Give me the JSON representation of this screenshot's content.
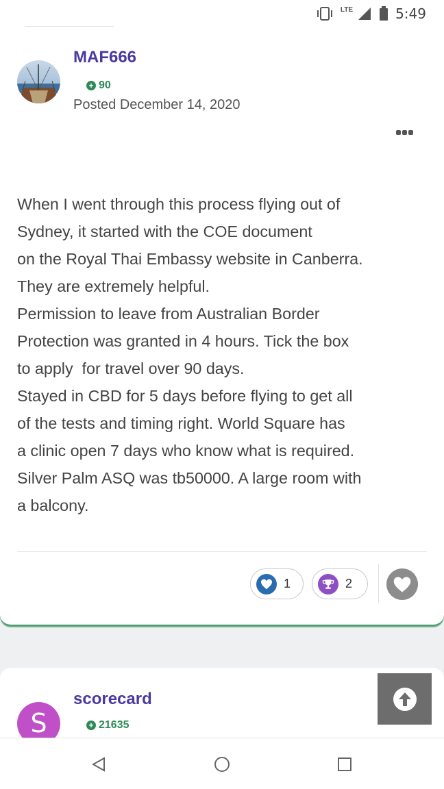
{
  "status_bar": {
    "time": "5:49",
    "network": "LTE",
    "icons": [
      "vibrate-icon",
      "signal-icon",
      "battery-icon"
    ]
  },
  "post": {
    "author": "MAF666",
    "reputation": "90",
    "posted": "Posted December 14, 2020",
    "body": [
      "When I went through this process flying out of",
      "Sydney, it started with the COE document",
      "on the Royal Thai Embassy website in Canberra.",
      "They are extremely helpful.",
      "Permission to leave from Australian Border",
      "Protection was granted in 4 hours. Tick the box",
      "to apply  for travel over 90 days.",
      "Stayed in CBD for 5 days before flying to get all",
      "of the tests and timing right. World Square has",
      "a clinic open 7 days who know what is required.",
      "Silver Palm ASQ was tb50000. A large room with",
      "a balcony."
    ],
    "reactions": {
      "like_count": "1",
      "trophy_count": "2"
    }
  },
  "next_post": {
    "author": "scorecard",
    "avatar_letter": "S",
    "reputation": "21635"
  },
  "colors": {
    "author": "#4a3aa0",
    "reputation": "#2f8a57",
    "like": "#2b6cb0",
    "trophy": "#8e4fc0",
    "avatar2": "#c050c8"
  }
}
